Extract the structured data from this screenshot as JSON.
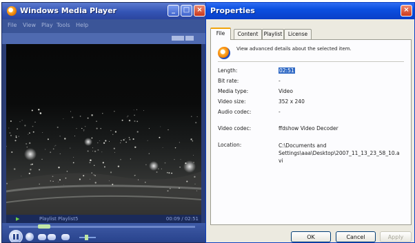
{
  "wmp": {
    "title": "Windows Media Player",
    "menu": [
      "File",
      "View",
      "Play",
      "Tools",
      "Help"
    ],
    "status": {
      "playlist": "Playlist  Playlist5",
      "time": "00:09 / 02:51"
    },
    "seek_progress": 0.2
  },
  "dialog": {
    "title": "Properties",
    "tabs": [
      "File",
      "Content",
      "Playlist",
      "License"
    ],
    "active_tab": "File",
    "description": "View advanced details about the selected item.",
    "fields": [
      {
        "label": "Length:",
        "value": "02:51"
      },
      {
        "label": "Bit rate:",
        "value": "-"
      },
      {
        "label": "Media type:",
        "value": "Video"
      },
      {
        "label": "Video size:",
        "value": "352 x 240"
      },
      {
        "label": "Audio codec:",
        "value": "-"
      },
      {
        "label": "Video codec:",
        "value": "ffdshow Video Decoder"
      },
      {
        "label": "Location:",
        "value": "C:\\Documents and\nSettings\\aaa\\Desktop\\2007_11_13_23_58_10.a\nvi"
      }
    ],
    "buttons": {
      "ok": "OK",
      "cancel": "Cancel",
      "apply": "Apply"
    }
  },
  "colors": {
    "wmp_frame": "#2a3c74",
    "xp_title_blue": "#0b4fe0",
    "selection": "#316ac5",
    "dialog_bg": "#eceae0"
  }
}
